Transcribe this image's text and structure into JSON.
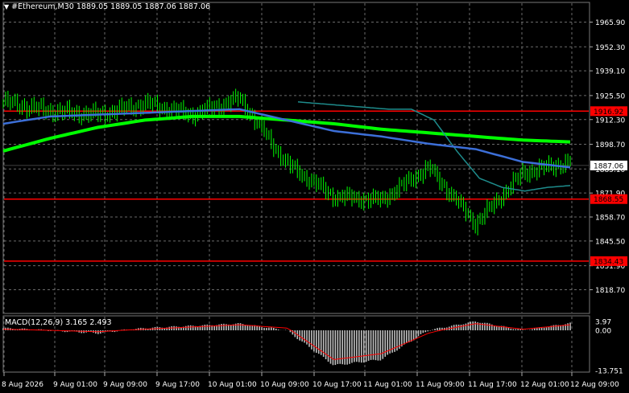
{
  "header": {
    "symbol": "#Ethereum,M30",
    "ohlc": "1889.05 1889.05 1887.06 1887.06"
  },
  "price_axis": {
    "ticks": [
      "1965.90",
      "1952.30",
      "1939.10",
      "1925.50",
      "1912.30",
      "1898.70",
      "1885.10",
      "1871.90",
      "1858.70",
      "1845.50",
      "1831.90",
      "1818.70"
    ]
  },
  "time_axis": {
    "labels": [
      "8 Aug 2026",
      "9 Aug 01:00",
      "9 Aug 09:00",
      "9 Aug 17:00",
      "10 Aug 01:00",
      "10 Aug 09:00",
      "10 Aug 17:00",
      "11 Aug 01:00",
      "11 Aug 09:00",
      "11 Aug 17:00",
      "12 Aug 01:00",
      "12 Aug 09:00"
    ]
  },
  "horizontal_levels": [
    {
      "label": "1916.92",
      "value": 1916.92,
      "color": "#ff0000"
    },
    {
      "label": "1868.55",
      "value": 1868.55,
      "color": "#ff0000"
    },
    {
      "label": "1834.43",
      "value": 1834.43,
      "color": "#ff0000"
    }
  ],
  "current_price": {
    "label": "1887.06",
    "value": 1887.06
  },
  "macd": {
    "label": "MACD(12,26,9) 3.165 2.493",
    "scale_labels": [
      "3.97",
      "0.00",
      "-13.751"
    ]
  },
  "colors": {
    "background": "#000000",
    "grid": "#6a6a6a",
    "candle": "#00ff00",
    "ma_fast": "#3c6fd8",
    "ma_mid": "#1e8c8c",
    "ma_slow": "#00ff00",
    "level": "#ff0000",
    "histogram": "#c0c0c0",
    "signal": "#ff0000",
    "text": "#ffffff"
  },
  "chart_data": {
    "type": "line",
    "title": "",
    "x": [
      "8 Aug 2026",
      "9 Aug 01:00",
      "9 Aug 09:00",
      "9 Aug 17:00",
      "10 Aug 01:00",
      "10 Aug 09:00",
      "10 Aug 17:00",
      "11 Aug 01:00",
      "11 Aug 09:00",
      "11 Aug 17:00",
      "12 Aug 01:00",
      "12 Aug 09:00"
    ],
    "ylim": [
      1818.7,
      1965.9
    ],
    "price": [
      1922,
      1917,
      1915,
      1921,
      1915,
      1924,
      1888,
      1870,
      1868,
      1886,
      1855,
      1883,
      1889
    ],
    "ma_fast": [
      1910,
      1914,
      1915,
      1916,
      1917,
      1918,
      1912,
      1906,
      1903,
      1899,
      1896,
      1889,
      1886
    ],
    "ma_mid": [
      1922,
      1921,
      1920,
      1919,
      1918,
      1918,
      1912,
      1895,
      1880,
      1875,
      1873,
      1875,
      1876
    ],
    "ma_slow": [
      1895,
      1902,
      1908,
      1912,
      1914,
      1914,
      1912,
      1910,
      1907,
      1905,
      1903,
      1901,
      1900
    ],
    "macd_hist": [
      1,
      0,
      -1,
      1,
      2,
      3,
      0,
      -12,
      -10,
      0,
      4,
      0,
      3.165
    ],
    "macd_signal": [
      0.5,
      0,
      -0.5,
      0.5,
      1.5,
      2.5,
      1,
      -10,
      -8,
      -1,
      3,
      0.5,
      2.493
    ],
    "macd_ylim": [
      -13.751,
      3.97
    ]
  }
}
